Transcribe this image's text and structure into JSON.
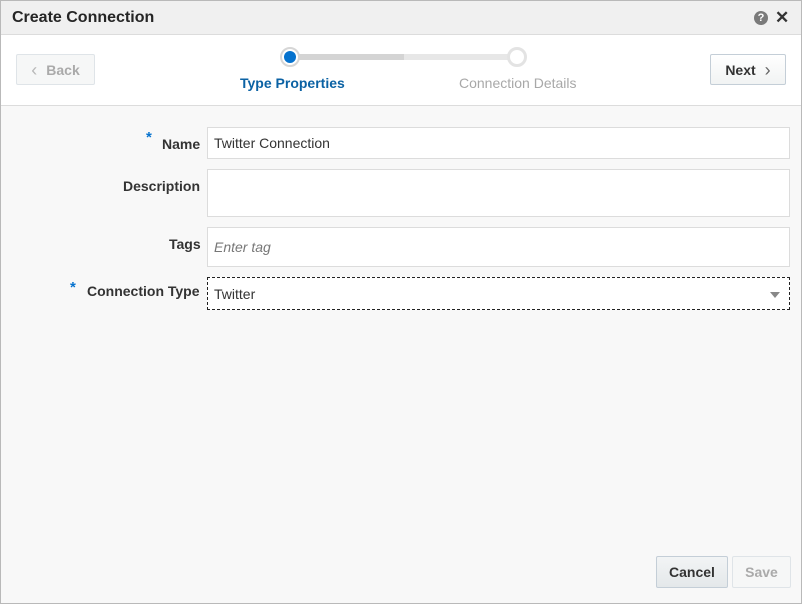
{
  "dialog": {
    "title": "Create Connection",
    "help_icon_glyph": "?",
    "close_icon_glyph": "✕"
  },
  "train": {
    "back_label": "Back",
    "next_label": "Next",
    "steps": [
      {
        "label": "Type Properties",
        "state": "current"
      },
      {
        "label": "Connection Details",
        "state": "pending"
      }
    ]
  },
  "form": {
    "required_marker": "*",
    "name": {
      "label": "Name",
      "value": "Twitter Connection",
      "required": true
    },
    "description": {
      "label": "Description",
      "value": ""
    },
    "tags": {
      "label": "Tags",
      "placeholder": "Enter tag"
    },
    "connection_type": {
      "label": "Connection Type",
      "value": "Twitter",
      "required": true
    }
  },
  "footer": {
    "cancel_label": "Cancel",
    "save_label": "Save"
  },
  "colors": {
    "accent": "#0572ce",
    "current_step_text": "#0b62a4",
    "pending_step_text": "#a8a8a8"
  },
  "icons": [
    "help-icon",
    "close-icon",
    "chevron-left-icon",
    "chevron-right-icon",
    "dropdown-arrow-icon"
  ]
}
